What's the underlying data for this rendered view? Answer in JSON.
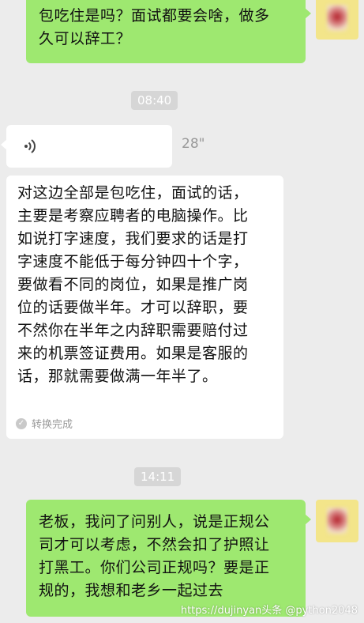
{
  "messages": {
    "top_sent": {
      "text": "包吃住是吗？面试都要会啥，做多\n久可以辞工？"
    },
    "time1": "08:40",
    "voice": {
      "icon": "voice-wave-icon",
      "duration": "28\""
    },
    "reply": {
      "text": "对这边全部是包吃住，面试的话，\n主要是考察应聘者的电脑操作。比\n如说打字速度，我们要求的话是打\n字速度不能低于每分钟四十个字，\n要做看不同的岗位，如果是推广岗\n位的话要做半年。才可以辞职，要\n不然你在半年之内辞职需要赔付过\n来的机票签证费用。如果是客服的\n话，那就需要做满一年半了。",
      "status": "转换完成"
    },
    "time2": "14:11",
    "bottom_sent": {
      "text": "老板，我问了问别人，说是正规公\n司才可以考虑，不然会扣了护照让\n打黑工。你们公司正规吗？要是正\n规的，我想和老乡一起过去"
    }
  },
  "watermark": "https://dujinyan头条 @python2048",
  "colors": {
    "sent_bubble": "#9ee870",
    "received_bubble": "#ffffff",
    "background": "#ececec"
  }
}
